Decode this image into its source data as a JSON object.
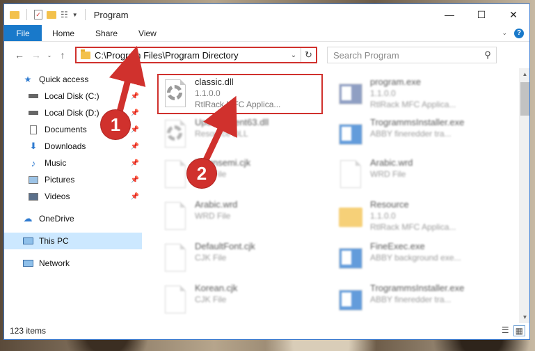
{
  "window": {
    "title": "Program"
  },
  "ribbon": {
    "tabs": [
      "File",
      "Home",
      "Share",
      "View"
    ]
  },
  "address": {
    "path": "C:\\Program Files\\Program Directory",
    "search_placeholder": "Search Program"
  },
  "nav": {
    "items": [
      {
        "label": "Quick access",
        "icon": "star-icon",
        "pinned": false
      },
      {
        "label": "Local Disk (C:)",
        "icon": "drive-icon",
        "pinned": true
      },
      {
        "label": "Local Disk (D:)",
        "icon": "drive-icon",
        "pinned": true
      },
      {
        "label": "Documents",
        "icon": "documents-icon",
        "pinned": true
      },
      {
        "label": "Downloads",
        "icon": "download-icon",
        "pinned": true
      },
      {
        "label": "Music",
        "icon": "music-icon",
        "pinned": true
      },
      {
        "label": "Pictures",
        "icon": "pictures-icon",
        "pinned": true
      },
      {
        "label": "Videos",
        "icon": "videos-icon",
        "pinned": true
      },
      {
        "label": "OneDrive",
        "icon": "cloud-icon",
        "pinned": false
      },
      {
        "label": "This PC",
        "icon": "computer-icon",
        "pinned": false
      },
      {
        "label": "Network",
        "icon": "network-icon",
        "pinned": false
      }
    ]
  },
  "files": {
    "selected": {
      "name": "classic.dll",
      "version": "1.1.0.0",
      "description": "RtlRack MFC Applica..."
    },
    "others": [
      {
        "name": "program.exe",
        "line2": "1.1.0.0",
        "line3": "RtlRack MFC Applica..."
      },
      {
        "name": "UpdateClient63.dll",
        "line2": "Resource DLL",
        "line3": ""
      },
      {
        "name": "TrogrammsInstaller.exe",
        "line2": "ABBY fineredder tra...",
        "line3": ""
      },
      {
        "name": "Dsignsemi.cjk",
        "line2": "CJK File",
        "line3": ""
      },
      {
        "name": "Arabic.wrd",
        "line2": "WRD File",
        "line3": ""
      },
      {
        "name": "Arabic.wrd",
        "line2": "WRD File",
        "line3": ""
      },
      {
        "name": "Resource",
        "line2": "1.1.0.0",
        "line3": "RtlRack MFC Applica..."
      },
      {
        "name": "DefaultFont.cjk",
        "line2": "CJK File",
        "line3": ""
      },
      {
        "name": "FineExec.exe",
        "line2": "ABBY background exe...",
        "line3": ""
      },
      {
        "name": "Korean.cjk",
        "line2": "CJK File",
        "line3": ""
      },
      {
        "name": "TrogrammsInstaller.exe",
        "line2": "ABBY fineredder tra...",
        "line3": ""
      }
    ]
  },
  "status": {
    "count": "123 items"
  },
  "callouts": {
    "one": "1",
    "two": "2"
  },
  "colors": {
    "accent": "#1979ca",
    "highlight": "#d0312d",
    "selected_nav": "#cce8ff"
  }
}
